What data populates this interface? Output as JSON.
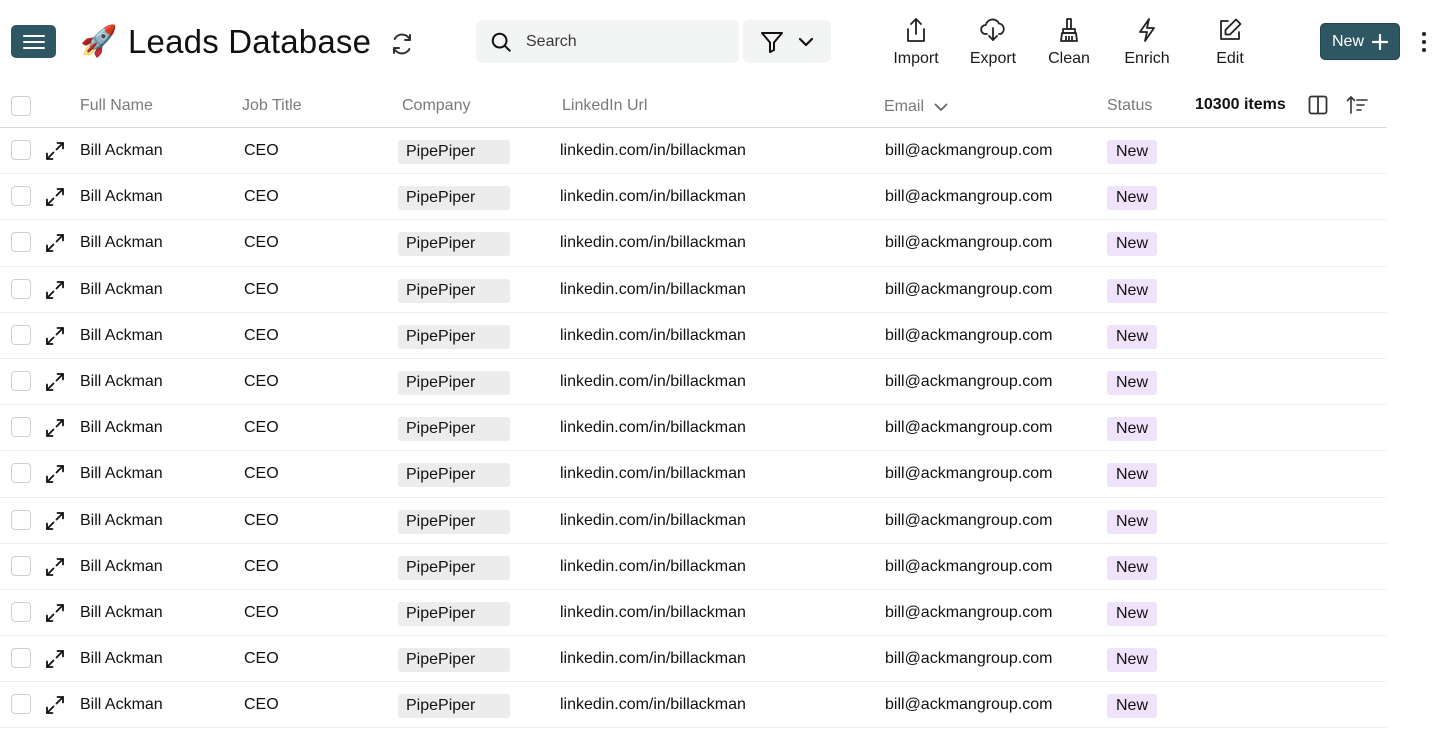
{
  "header": {
    "title": "Leads Database",
    "title_emoji": "🚀",
    "search_placeholder": "Search",
    "toolbar": [
      {
        "label": "Import",
        "icon": "upload-icon"
      },
      {
        "label": "Export",
        "icon": "cloud-download-icon"
      },
      {
        "label": "Clean",
        "icon": "broom-icon"
      },
      {
        "label": "Enrich",
        "icon": "lightning-icon"
      },
      {
        "label": "Edit",
        "icon": "edit-icon"
      }
    ],
    "new_label": "New"
  },
  "colors": {
    "primary": "#2f5663",
    "status_bg": "#efe2fb",
    "chip_bg": "#ececec",
    "search_bg": "#f3f4f4"
  },
  "table": {
    "columns": [
      "Full Name",
      "Job Title",
      "Company",
      "LinkedIn Url",
      "Email",
      "Status"
    ],
    "items_count": "10300 items",
    "rows": [
      {
        "name": "Bill Ackman",
        "job": "CEO",
        "company": "PipePiper",
        "linkedin": "linkedin.com/in/billackman",
        "email": "bill@ackmangroup.com",
        "status": "New"
      },
      {
        "name": "Bill Ackman",
        "job": "CEO",
        "company": "PipePiper",
        "linkedin": "linkedin.com/in/billackman",
        "email": "bill@ackmangroup.com",
        "status": "New"
      },
      {
        "name": "Bill Ackman",
        "job": "CEO",
        "company": "PipePiper",
        "linkedin": "linkedin.com/in/billackman",
        "email": "bill@ackmangroup.com",
        "status": "New"
      },
      {
        "name": "Bill Ackman",
        "job": "CEO",
        "company": "PipePiper",
        "linkedin": "linkedin.com/in/billackman",
        "email": "bill@ackmangroup.com",
        "status": "New"
      },
      {
        "name": "Bill Ackman",
        "job": "CEO",
        "company": "PipePiper",
        "linkedin": "linkedin.com/in/billackman",
        "email": "bill@ackmangroup.com",
        "status": "New"
      },
      {
        "name": "Bill Ackman",
        "job": "CEO",
        "company": "PipePiper",
        "linkedin": "linkedin.com/in/billackman",
        "email": "bill@ackmangroup.com",
        "status": "New"
      },
      {
        "name": "Bill Ackman",
        "job": "CEO",
        "company": "PipePiper",
        "linkedin": "linkedin.com/in/billackman",
        "email": "bill@ackmangroup.com",
        "status": "New"
      },
      {
        "name": "Bill Ackman",
        "job": "CEO",
        "company": "PipePiper",
        "linkedin": "linkedin.com/in/billackman",
        "email": "bill@ackmangroup.com",
        "status": "New"
      },
      {
        "name": "Bill Ackman",
        "job": "CEO",
        "company": "PipePiper",
        "linkedin": "linkedin.com/in/billackman",
        "email": "bill@ackmangroup.com",
        "status": "New"
      },
      {
        "name": "Bill Ackman",
        "job": "CEO",
        "company": "PipePiper",
        "linkedin": "linkedin.com/in/billackman",
        "email": "bill@ackmangroup.com",
        "status": "New"
      },
      {
        "name": "Bill Ackman",
        "job": "CEO",
        "company": "PipePiper",
        "linkedin": "linkedin.com/in/billackman",
        "email": "bill@ackmangroup.com",
        "status": "New"
      },
      {
        "name": "Bill Ackman",
        "job": "CEO",
        "company": "PipePiper",
        "linkedin": "linkedin.com/in/billackman",
        "email": "bill@ackmangroup.com",
        "status": "New"
      },
      {
        "name": "Bill Ackman",
        "job": "CEO",
        "company": "PipePiper",
        "linkedin": "linkedin.com/in/billackman",
        "email": "bill@ackmangroup.com",
        "status": "New"
      }
    ]
  }
}
